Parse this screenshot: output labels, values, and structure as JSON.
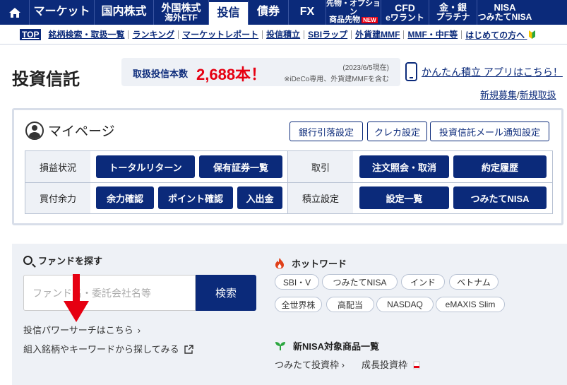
{
  "nav": {
    "items": [
      {
        "label": "マーケット"
      },
      {
        "label": "国内株式"
      },
      {
        "label1": "外国株式",
        "label2": "海外ETF"
      },
      {
        "label": "投信"
      },
      {
        "label": "債券"
      },
      {
        "label": "FX"
      },
      {
        "label1": "先物・オプション",
        "label2": "商品先物",
        "badge": "NEW"
      },
      {
        "label1": "CFD",
        "label2": "eワラント"
      },
      {
        "label1": "金・銀",
        "label2": "プラチナ"
      },
      {
        "label1": "NISA",
        "label2": "つみたてNISA"
      }
    ]
  },
  "subnav": {
    "top": "TOP",
    "links": [
      "銘柄検索・取扱一覧",
      "ランキング",
      "マーケットレポート",
      "投信積立",
      "SBIラップ",
      "外貨建MMF",
      "MMF・中F等",
      "はじめての方へ"
    ]
  },
  "page": {
    "title": "投資信託",
    "count_label": "取扱投信本数",
    "count_value": "2,688本！",
    "count_date": "(2023/6/5現在)",
    "count_note": "※iDeCo専用、外貨建MMFを含む",
    "app_link": "かんたん積立 アプリはこちら！",
    "reg_new": "新規募集",
    "reg_sep": "/",
    "reg_stop": "新規取扱"
  },
  "mypage": {
    "title": "マイページ",
    "top_buttons": [
      "銀行引落設定",
      "クレカ設定",
      "投資信託メール通知設定"
    ],
    "rows": {
      "pl_label": "損益状況",
      "pl_btn1": "トータルリターン",
      "pl_btn2": "保有証券一覧",
      "trade_label": "取引",
      "trade_btn1": "注文照会・取消",
      "trade_btn2": "約定履歴",
      "buy_label": "買付余力",
      "buy_btn1": "余力確認",
      "buy_btn2": "ポイント確認",
      "buy_btn3": "入出金",
      "acc_label": "積立設定",
      "acc_btn1": "設定一覧",
      "acc_btn2": "つみたてNISA"
    }
  },
  "search": {
    "title": "ファンドを探す",
    "placeholder": "ファンド名・委託会社名等",
    "button": "検索",
    "link1": "投信パワーサーチはこちら",
    "link2": "組入銘柄やキーワードから探してみる"
  },
  "hotwords": {
    "title": "ホットワード",
    "tags": [
      "SBI・V",
      "つみたてNISA",
      "インド",
      "ベトナム",
      "全世界株",
      "高配当",
      "NASDAQ",
      "eMAXIS Slim"
    ]
  },
  "nisa_list": {
    "title": "新NISA対象商品一覧",
    "link1": "つみたて投資枠",
    "link2": "成長投資枠"
  },
  "colors": {
    "brand": "#0b2a7a",
    "accent": "#e60012",
    "panel": "#eef1f6"
  }
}
